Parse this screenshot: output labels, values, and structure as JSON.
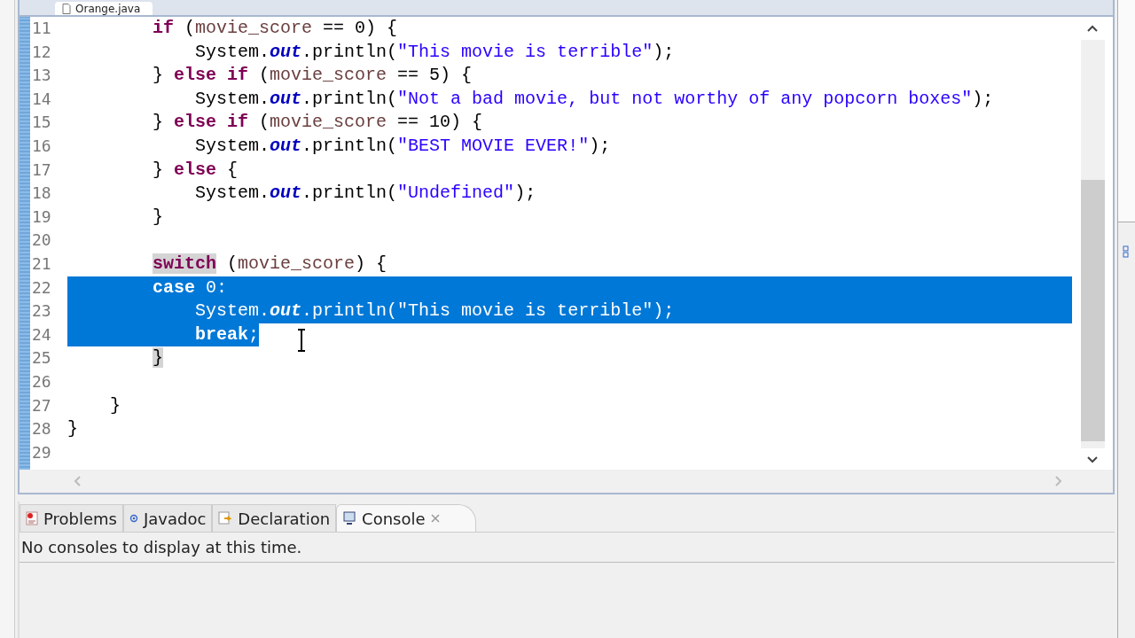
{
  "editor_tab": {
    "title": "Orange.java"
  },
  "code_lines": [
    {
      "number": "11",
      "selected": false,
      "tokens": [
        {
          "kind": "keyword",
          "text": "        if"
        },
        {
          "kind": "plain",
          "text": " ("
        },
        {
          "kind": "var",
          "text": "movie_score"
        },
        {
          "kind": "plain",
          "text": " == 0) {"
        }
      ]
    },
    {
      "number": "12",
      "selected": false,
      "tokens": [
        {
          "kind": "plain",
          "text": "            System."
        },
        {
          "kind": "field",
          "text": "out"
        },
        {
          "kind": "plain",
          "text": ".println("
        },
        {
          "kind": "string",
          "text": "\"This movie is terrible\""
        },
        {
          "kind": "plain",
          "text": ");"
        }
      ]
    },
    {
      "number": "13",
      "selected": false,
      "tokens": [
        {
          "kind": "plain",
          "text": "        } "
        },
        {
          "kind": "keyword",
          "text": "else if"
        },
        {
          "kind": "plain",
          "text": " ("
        },
        {
          "kind": "var",
          "text": "movie_score"
        },
        {
          "kind": "plain",
          "text": " == 5) {"
        }
      ]
    },
    {
      "number": "14",
      "selected": false,
      "tokens": [
        {
          "kind": "plain",
          "text": "            System."
        },
        {
          "kind": "field",
          "text": "out"
        },
        {
          "kind": "plain",
          "text": ".println("
        },
        {
          "kind": "string",
          "text": "\"Not a bad movie, but not worthy of any popcorn boxes\""
        },
        {
          "kind": "plain",
          "text": ");"
        }
      ]
    },
    {
      "number": "15",
      "selected": false,
      "tokens": [
        {
          "kind": "plain",
          "text": "        } "
        },
        {
          "kind": "keyword",
          "text": "else if"
        },
        {
          "kind": "plain",
          "text": " ("
        },
        {
          "kind": "var",
          "text": "movie_score"
        },
        {
          "kind": "plain",
          "text": " == 10) {"
        }
      ]
    },
    {
      "number": "16",
      "selected": false,
      "tokens": [
        {
          "kind": "plain",
          "text": "            System."
        },
        {
          "kind": "field",
          "text": "out"
        },
        {
          "kind": "plain",
          "text": ".println("
        },
        {
          "kind": "string",
          "text": "\"BEST MOVIE EVER!\""
        },
        {
          "kind": "plain",
          "text": ");"
        }
      ]
    },
    {
      "number": "17",
      "selected": false,
      "tokens": [
        {
          "kind": "plain",
          "text": "        } "
        },
        {
          "kind": "keyword",
          "text": "else"
        },
        {
          "kind": "plain",
          "text": " {"
        }
      ]
    },
    {
      "number": "18",
      "selected": false,
      "tokens": [
        {
          "kind": "plain",
          "text": "            System."
        },
        {
          "kind": "field",
          "text": "out"
        },
        {
          "kind": "plain",
          "text": ".println("
        },
        {
          "kind": "string",
          "text": "\"Undefined\""
        },
        {
          "kind": "plain",
          "text": ");"
        }
      ]
    },
    {
      "number": "19",
      "selected": false,
      "tokens": [
        {
          "kind": "plain",
          "text": "        }"
        }
      ]
    },
    {
      "number": "20",
      "selected": false
    },
    {
      "number": "21",
      "selected": false,
      "tokens": [
        {
          "kind": "keyword",
          "text": "        switch",
          "marked": true
        },
        {
          "kind": "plain",
          "text": " ("
        },
        {
          "kind": "var",
          "text": "movie_score"
        },
        {
          "kind": "plain",
          "text": ") {"
        }
      ]
    },
    {
      "number": "22",
      "selected": true,
      "tokens": [
        {
          "kind": "keyword",
          "text": "        case"
        },
        {
          "kind": "plain",
          "text": " 0:"
        }
      ]
    },
    {
      "number": "23",
      "selected": true,
      "tokens": [
        {
          "kind": "plain",
          "text": "            System."
        },
        {
          "kind": "field",
          "text": "out"
        },
        {
          "kind": "plain",
          "text": ".println("
        },
        {
          "kind": "string",
          "text": "\"This movie is terrible\""
        },
        {
          "kind": "plain",
          "text": ");"
        }
      ]
    },
    {
      "number": "24",
      "selected": true,
      "tokens": [
        {
          "kind": "keyword",
          "text": "            break"
        },
        {
          "kind": "plain",
          "text": ";"
        }
      ]
    },
    {
      "number": "25",
      "selected": false,
      "tokens": [
        {
          "kind": "plain",
          "text": "        }",
          "marked": true
        }
      ]
    },
    {
      "number": "26",
      "selected": false
    },
    {
      "number": "27",
      "selected": false,
      "tokens": [
        {
          "kind": "plain",
          "text": "    }"
        }
      ]
    },
    {
      "number": "28",
      "selected": false,
      "tokens": [
        {
          "kind": "plain",
          "text": "}"
        }
      ]
    },
    {
      "number": "29",
      "selected": false
    }
  ],
  "bottom_tabs": [
    {
      "label": "Problems",
      "selected": false
    },
    {
      "label": "Javadoc",
      "selected": false
    },
    {
      "label": "Declaration",
      "selected": false
    },
    {
      "label": "Console",
      "selected": true
    }
  ],
  "console": {
    "message": "No consoles to display at this time."
  }
}
